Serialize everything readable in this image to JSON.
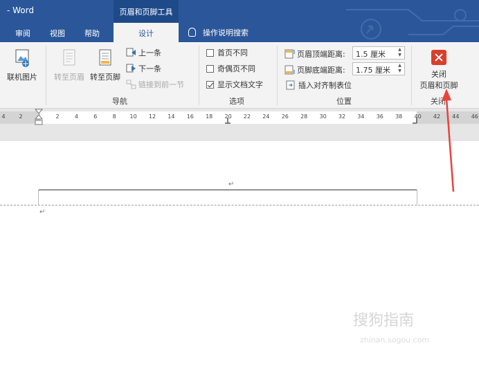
{
  "titlebar": {
    "app_name": "- Word",
    "context_tab": "页眉和页脚工具"
  },
  "tabs": [
    {
      "label": "审阅"
    },
    {
      "label": "视图"
    },
    {
      "label": "帮助"
    },
    {
      "label": "设计"
    }
  ],
  "tell_me": "操作说明搜索",
  "ribbon": {
    "insert": {
      "online_picture": "联机图片"
    },
    "navigation": {
      "goto_header": "转至页眉",
      "goto_footer": "转至页脚",
      "previous": "上一条",
      "next": "下一条",
      "link_previous": "链接到前一节",
      "label": "导航"
    },
    "options": {
      "different_first_page": "首页不同",
      "different_odd_even": "奇偶页不同",
      "show_document_text": "显示文档文字",
      "label": "选项"
    },
    "position": {
      "header_from_top_label": "页眉顶端距离:",
      "header_from_top_value": "1.5 厘米",
      "footer_from_bottom_label": "页脚底端距离:",
      "footer_from_bottom_value": "1.75 厘米",
      "insert_alignment_tab": "插入对齐制表位",
      "label": "位置"
    },
    "close": {
      "line1": "关闭",
      "line2": "页眉和页脚",
      "label": "关闭"
    }
  },
  "ruler": {
    "left_labels": [
      "4",
      "2"
    ],
    "labels": [
      "2",
      "4",
      "6",
      "8",
      "10",
      "12",
      "14",
      "16",
      "18",
      "20",
      "22",
      "24",
      "26",
      "28",
      "30",
      "32",
      "34",
      "36",
      "38",
      "40",
      "42",
      "44",
      "46"
    ]
  },
  "document": {
    "paragraph_mark": "↵"
  },
  "watermark": {
    "text": "搜狗指南",
    "sub": "zhinan.sogou.com"
  },
  "colors": {
    "brand": "#2b579a",
    "close_red": "#d9402b",
    "arrow": "#e8433a"
  }
}
